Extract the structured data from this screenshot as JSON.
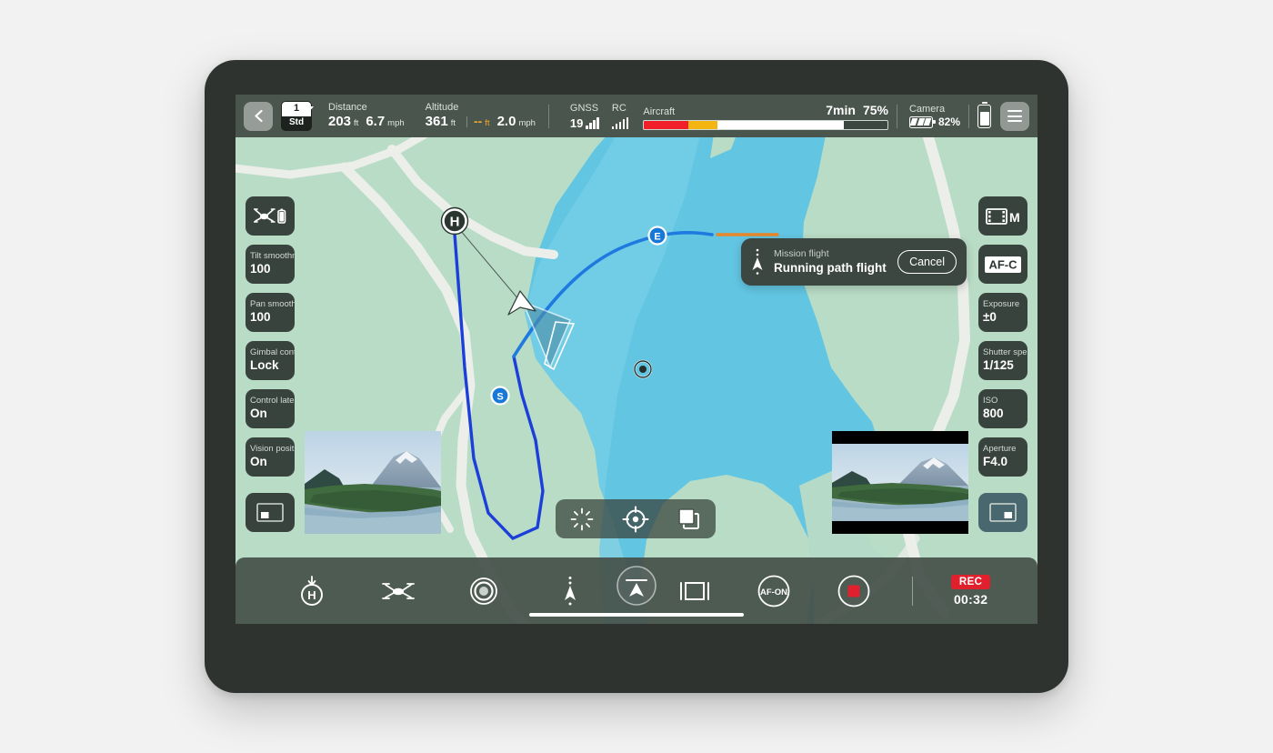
{
  "status_bar": {
    "back_icon": "chevron-left-icon",
    "flight_mode": {
      "number": "1",
      "label": "Std"
    },
    "distance": {
      "label": "Distance",
      "value": "203",
      "unit": "ft",
      "speed": "6.7",
      "speed_unit": "mph"
    },
    "altitude": {
      "label": "Altitude",
      "value": "361",
      "unit": "ft",
      "relative": "--",
      "relative_unit": "ft",
      "speed": "2.0",
      "speed_unit": "mph"
    },
    "gnss": {
      "label": "GNSS",
      "value": "19",
      "bars": 4,
      "bars_total": 4
    },
    "rc": {
      "label": "RC",
      "bars": 5,
      "bars_total": 5
    },
    "aircraft": {
      "label": "Aircraft",
      "time_remaining": "7min",
      "percent_text": "75%",
      "percent": 75,
      "critical_pct": 18,
      "warning_pct": 12,
      "marker_pct": 30,
      "reserve_pct": 18,
      "critical_color": "#f01f2a",
      "warning_color": "#f5b510",
      "fill_color": "#ffffff",
      "reserve_color": "#3d4742"
    },
    "camera": {
      "label": "Camera",
      "percent_text": "82%"
    },
    "rc_battery": {
      "percent": 72
    },
    "menu_icon": "hamburger-menu-icon"
  },
  "mission_toast": {
    "icon": "flight-path-icon",
    "title": "Mission flight",
    "subtitle": "Running path flight",
    "cancel_label": "Cancel"
  },
  "left_panel": [
    {
      "name": "aircraft-battery",
      "type": "icon",
      "icon": "drone-battery-icon"
    },
    {
      "name": "tilt-smoothness",
      "type": "value",
      "label": "Tilt smoothness",
      "value": "100"
    },
    {
      "name": "pan-smoothness",
      "type": "value",
      "label": "Pan smoothness",
      "value": "100"
    },
    {
      "name": "gimbal-control",
      "type": "value",
      "label": "Gimbal control",
      "value": "Lock"
    },
    {
      "name": "control-latency",
      "type": "value",
      "label": "Control latency",
      "value": "On"
    },
    {
      "name": "vision-positioning",
      "type": "value",
      "label": "Vision positioning",
      "value": "On"
    },
    {
      "name": "pip-toggle-left",
      "type": "icon",
      "icon": "pip-bottom-left-icon"
    }
  ],
  "right_panel": [
    {
      "name": "video-mode",
      "type": "icon",
      "icon": "film-m-icon",
      "text": "M"
    },
    {
      "name": "focus-mode",
      "type": "icon",
      "icon": "af-c-icon",
      "text": "AF-C"
    },
    {
      "name": "exposure",
      "type": "value",
      "label": "Exposure",
      "value": "±0"
    },
    {
      "name": "shutter-speed",
      "type": "value",
      "label": "Shutter speed",
      "value": "1/125"
    },
    {
      "name": "iso",
      "type": "value",
      "label": "ISO",
      "value": "800"
    },
    {
      "name": "aperture",
      "type": "value",
      "label": "Aperture",
      "value": "F4.0"
    },
    {
      "name": "pip-toggle-right",
      "type": "icon",
      "icon": "pip-bottom-right-icon",
      "active": true
    }
  ],
  "center_tools": [
    {
      "name": "exposure-burst-tool",
      "icon": "sunburst-icon"
    },
    {
      "name": "focus-target-tool",
      "icon": "crosshair-target-icon"
    },
    {
      "name": "layers-tool",
      "icon": "layers-stack-icon"
    }
  ],
  "bottom_bar": {
    "left_buttons": [
      {
        "name": "return-to-home-button",
        "icon": "return-home-icon"
      },
      {
        "name": "takeoff-landing-button",
        "icon": "drone-icon"
      },
      {
        "name": "focus-point-button",
        "icon": "focus-ring-icon"
      },
      {
        "name": "waypoint-flight-button",
        "icon": "flight-path-icon"
      }
    ],
    "right_buttons": [
      {
        "name": "framing-guide-button",
        "icon": "frame-guide-icon"
      },
      {
        "name": "af-on-button",
        "icon": "af-on-icon",
        "text": "AF-ON"
      },
      {
        "name": "record-stop-button",
        "icon": "record-stop-icon"
      }
    ],
    "compass_button": {
      "name": "compass-button",
      "icon": "compass-north-icon"
    },
    "recording": {
      "badge": "REC",
      "timer": "00:32"
    }
  },
  "map": {
    "home_marker": "H",
    "start_marker": "S",
    "end_marker": "E",
    "poi_marker": "poi-target-icon",
    "aircraft_marker": "aircraft-heading-icon",
    "colors": {
      "land": "#b9dcc6",
      "water": "#62c6e3",
      "water_deep": "#7ed0e8",
      "road": "#eceeea",
      "path": "#1b4ee0",
      "path_active": "#1f7ae0",
      "heading_cone": "#4e8fa8",
      "end_line": "#e8872a",
      "marker_blue": "#1878d8"
    }
  },
  "thumbnails": {
    "left": {
      "name": "camera-preview-left",
      "scene": "mountain-lake-landscape"
    },
    "right": {
      "name": "camera-preview-right",
      "scene": "mountain-lake-landscape",
      "letterboxed": true
    }
  }
}
